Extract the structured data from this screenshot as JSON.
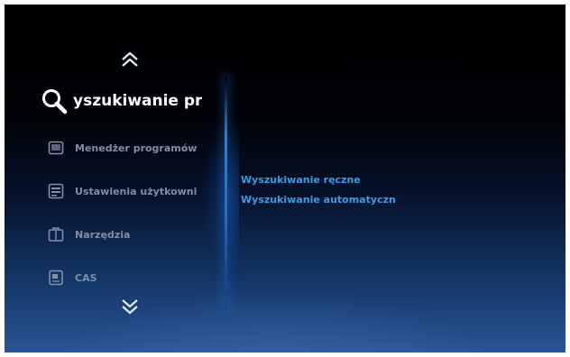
{
  "menu": {
    "selected": {
      "label": "yszukiwanie pr",
      "icon": "search-icon"
    },
    "items": [
      {
        "label": "Menedżer programów",
        "icon": "program-manager-icon"
      },
      {
        "label": "Ustawienia użytkowni",
        "icon": "user-settings-icon"
      },
      {
        "label": "Narzędzia",
        "icon": "tools-icon"
      },
      {
        "label": "CAS",
        "icon": "cas-card-icon"
      }
    ]
  },
  "submenu": {
    "items": [
      {
        "label": "Wyszukiwanie ręczne"
      },
      {
        "label": "Wyszukiwanie automatyczn"
      }
    ]
  },
  "colors": {
    "selected_text": "#ffffff",
    "menu_text": "#7f8ea6",
    "submenu_text": "#3e9be6",
    "accent": "#2f8be0"
  }
}
